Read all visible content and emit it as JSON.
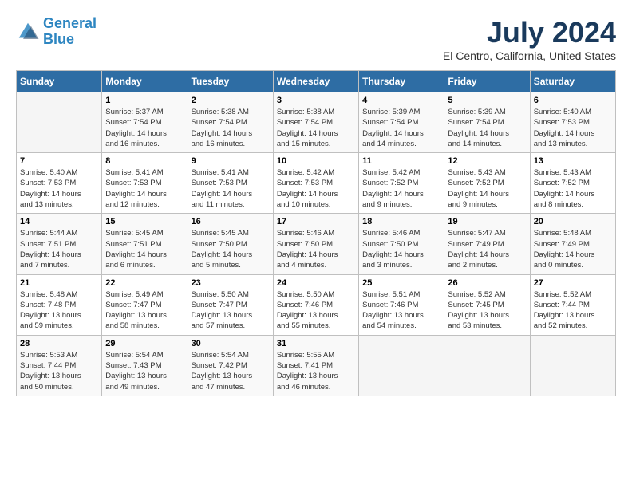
{
  "logo": {
    "line1": "General",
    "line2": "Blue"
  },
  "title": "July 2024",
  "location": "El Centro, California, United States",
  "days_of_week": [
    "Sunday",
    "Monday",
    "Tuesday",
    "Wednesday",
    "Thursday",
    "Friday",
    "Saturday"
  ],
  "weeks": [
    [
      {
        "day": "",
        "info": ""
      },
      {
        "day": "1",
        "info": "Sunrise: 5:37 AM\nSunset: 7:54 PM\nDaylight: 14 hours\nand 16 minutes."
      },
      {
        "day": "2",
        "info": "Sunrise: 5:38 AM\nSunset: 7:54 PM\nDaylight: 14 hours\nand 16 minutes."
      },
      {
        "day": "3",
        "info": "Sunrise: 5:38 AM\nSunset: 7:54 PM\nDaylight: 14 hours\nand 15 minutes."
      },
      {
        "day": "4",
        "info": "Sunrise: 5:39 AM\nSunset: 7:54 PM\nDaylight: 14 hours\nand 14 minutes."
      },
      {
        "day": "5",
        "info": "Sunrise: 5:39 AM\nSunset: 7:54 PM\nDaylight: 14 hours\nand 14 minutes."
      },
      {
        "day": "6",
        "info": "Sunrise: 5:40 AM\nSunset: 7:53 PM\nDaylight: 14 hours\nand 13 minutes."
      }
    ],
    [
      {
        "day": "7",
        "info": "Sunrise: 5:40 AM\nSunset: 7:53 PM\nDaylight: 14 hours\nand 13 minutes."
      },
      {
        "day": "8",
        "info": "Sunrise: 5:41 AM\nSunset: 7:53 PM\nDaylight: 14 hours\nand 12 minutes."
      },
      {
        "day": "9",
        "info": "Sunrise: 5:41 AM\nSunset: 7:53 PM\nDaylight: 14 hours\nand 11 minutes."
      },
      {
        "day": "10",
        "info": "Sunrise: 5:42 AM\nSunset: 7:53 PM\nDaylight: 14 hours\nand 10 minutes."
      },
      {
        "day": "11",
        "info": "Sunrise: 5:42 AM\nSunset: 7:52 PM\nDaylight: 14 hours\nand 9 minutes."
      },
      {
        "day": "12",
        "info": "Sunrise: 5:43 AM\nSunset: 7:52 PM\nDaylight: 14 hours\nand 9 minutes."
      },
      {
        "day": "13",
        "info": "Sunrise: 5:43 AM\nSunset: 7:52 PM\nDaylight: 14 hours\nand 8 minutes."
      }
    ],
    [
      {
        "day": "14",
        "info": "Sunrise: 5:44 AM\nSunset: 7:51 PM\nDaylight: 14 hours\nand 7 minutes."
      },
      {
        "day": "15",
        "info": "Sunrise: 5:45 AM\nSunset: 7:51 PM\nDaylight: 14 hours\nand 6 minutes."
      },
      {
        "day": "16",
        "info": "Sunrise: 5:45 AM\nSunset: 7:50 PM\nDaylight: 14 hours\nand 5 minutes."
      },
      {
        "day": "17",
        "info": "Sunrise: 5:46 AM\nSunset: 7:50 PM\nDaylight: 14 hours\nand 4 minutes."
      },
      {
        "day": "18",
        "info": "Sunrise: 5:46 AM\nSunset: 7:50 PM\nDaylight: 14 hours\nand 3 minutes."
      },
      {
        "day": "19",
        "info": "Sunrise: 5:47 AM\nSunset: 7:49 PM\nDaylight: 14 hours\nand 2 minutes."
      },
      {
        "day": "20",
        "info": "Sunrise: 5:48 AM\nSunset: 7:49 PM\nDaylight: 14 hours\nand 0 minutes."
      }
    ],
    [
      {
        "day": "21",
        "info": "Sunrise: 5:48 AM\nSunset: 7:48 PM\nDaylight: 13 hours\nand 59 minutes."
      },
      {
        "day": "22",
        "info": "Sunrise: 5:49 AM\nSunset: 7:47 PM\nDaylight: 13 hours\nand 58 minutes."
      },
      {
        "day": "23",
        "info": "Sunrise: 5:50 AM\nSunset: 7:47 PM\nDaylight: 13 hours\nand 57 minutes."
      },
      {
        "day": "24",
        "info": "Sunrise: 5:50 AM\nSunset: 7:46 PM\nDaylight: 13 hours\nand 55 minutes."
      },
      {
        "day": "25",
        "info": "Sunrise: 5:51 AM\nSunset: 7:46 PM\nDaylight: 13 hours\nand 54 minutes."
      },
      {
        "day": "26",
        "info": "Sunrise: 5:52 AM\nSunset: 7:45 PM\nDaylight: 13 hours\nand 53 minutes."
      },
      {
        "day": "27",
        "info": "Sunrise: 5:52 AM\nSunset: 7:44 PM\nDaylight: 13 hours\nand 52 minutes."
      }
    ],
    [
      {
        "day": "28",
        "info": "Sunrise: 5:53 AM\nSunset: 7:44 PM\nDaylight: 13 hours\nand 50 minutes."
      },
      {
        "day": "29",
        "info": "Sunrise: 5:54 AM\nSunset: 7:43 PM\nDaylight: 13 hours\nand 49 minutes."
      },
      {
        "day": "30",
        "info": "Sunrise: 5:54 AM\nSunset: 7:42 PM\nDaylight: 13 hours\nand 47 minutes."
      },
      {
        "day": "31",
        "info": "Sunrise: 5:55 AM\nSunset: 7:41 PM\nDaylight: 13 hours\nand 46 minutes."
      },
      {
        "day": "",
        "info": ""
      },
      {
        "day": "",
        "info": ""
      },
      {
        "day": "",
        "info": ""
      }
    ]
  ]
}
